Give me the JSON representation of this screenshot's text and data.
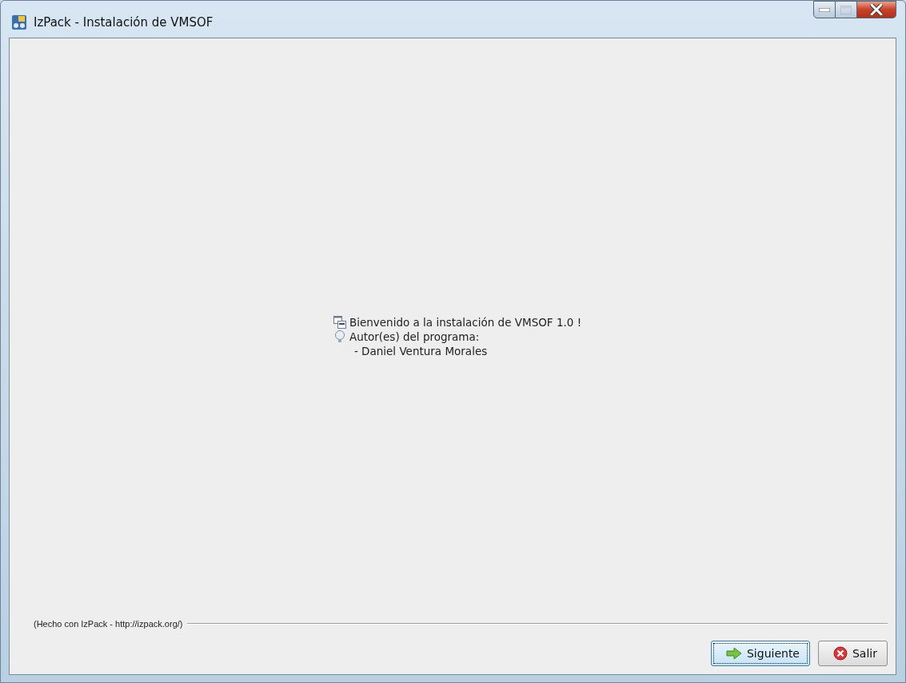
{
  "window": {
    "title": "IzPack - Instalación de VMSOF"
  },
  "welcome": [
    {
      "kind": "info",
      "text": "Bienvenido a la instalación de VMSOF 1.0 !"
    },
    {
      "kind": "hint",
      "text": "Autor(es) del programa:"
    },
    {
      "kind": "plain",
      "text": "- Daniel Ventura Morales"
    }
  ],
  "footer": {
    "credit": "(Hecho con IzPack - http://izpack.org/)"
  },
  "buttons": [
    {
      "kind": "next",
      "label": "Siguiente",
      "focused": true
    },
    {
      "kind": "exit",
      "label": "Salir",
      "focused": false
    }
  ]
}
